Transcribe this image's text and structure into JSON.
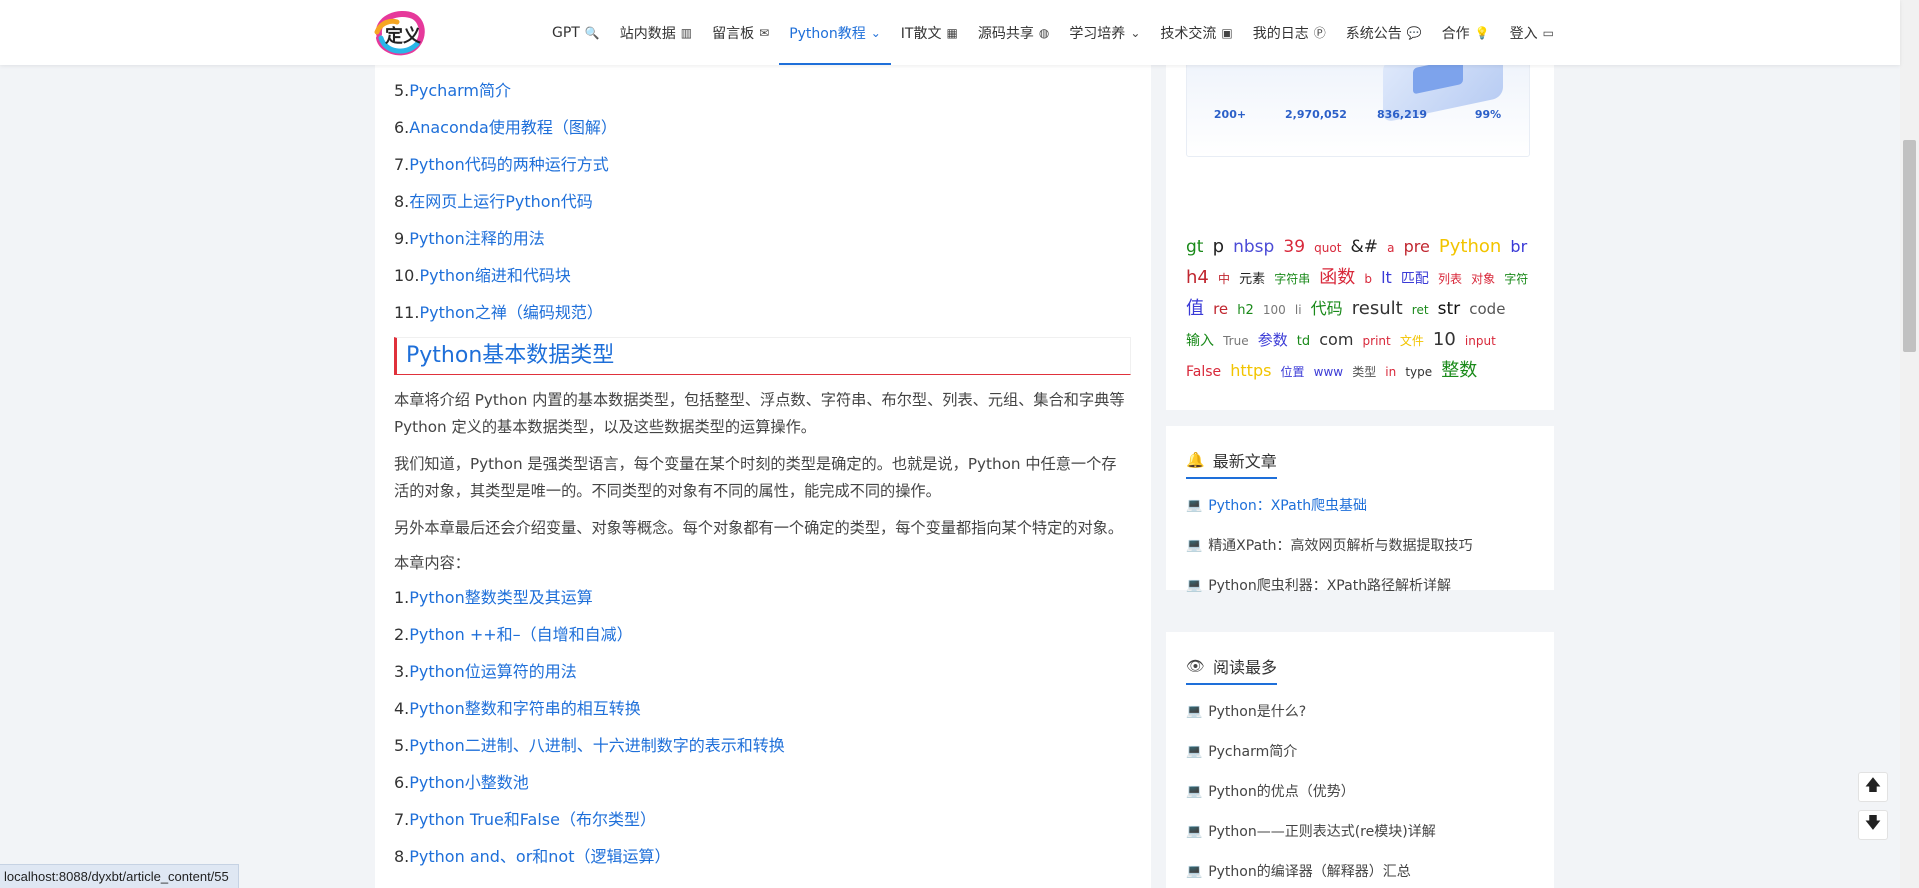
{
  "logo": {
    "text": "定义"
  },
  "nav": [
    {
      "label": "GPT",
      "icon": "🔍",
      "active": false
    },
    {
      "label": "站内数据",
      "icon": "▥",
      "active": false
    },
    {
      "label": "留言板",
      "icon": "✉",
      "active": false
    },
    {
      "label": "Python教程",
      "icon": "⌄",
      "active": true
    },
    {
      "label": "IT散文",
      "icon": "▦",
      "active": false
    },
    {
      "label": "源码共享",
      "icon": "◍",
      "active": false
    },
    {
      "label": "学习培养",
      "icon": "⌄",
      "active": false
    },
    {
      "label": "技术交流",
      "icon": "▣",
      "active": false
    },
    {
      "label": "我的日志",
      "icon": "Ⓟ",
      "active": false
    },
    {
      "label": "系统公告",
      "icon": "💬",
      "active": false
    },
    {
      "label": "合作",
      "icon": "💡",
      "active": false
    },
    {
      "label": "登入",
      "icon": "▭",
      "active": false
    }
  ],
  "article": {
    "top_items": [
      {
        "num": "5.",
        "title": "Pycharm简介"
      },
      {
        "num": "6.",
        "title": "Anaconda使用教程（图解）"
      },
      {
        "num": "7.",
        "title": "Python代码的两种运行方式"
      },
      {
        "num": "8.",
        "title": "在网页上运行Python代码"
      },
      {
        "num": "9.",
        "title": "Python注释的用法"
      },
      {
        "num": "10.",
        "title": "Python缩进和代码块"
      },
      {
        "num": "11.",
        "title": "Python之禅（编码规范）"
      }
    ],
    "section_title": "Python基本数据类型",
    "paragraphs": [
      "本章将介绍 Python 内置的基本数据类型，包括整型、浮点数、字符串、布尔型、列表、元组、集合和字典等 Python 定义的基本数据类型，以及这些数据类型的运算操作。",
      "我们知道，Python 是强类型语言，每个变量在某个时刻的类型是确定的。也就是说，Python 中任意一个存活的对象，其类型是唯一的。不同类型的对象有不同的属性，能完成不同的操作。",
      "另外本章最后还会介绍变量、对象等概念。每个对象都有一个确定的类型，每个变量都指向某个特定的对象。"
    ],
    "chapter_label": "本章内容：",
    "bottom_items": [
      {
        "num": "1.",
        "title": "Python整数类型及其运算"
      },
      {
        "num": "2.",
        "title": "Python ++和–（自增和自减）"
      },
      {
        "num": "3.",
        "title": "Python位运算符的用法"
      },
      {
        "num": "4.",
        "title": "Python整数和字符串的相互转换"
      },
      {
        "num": "5.",
        "title": "Python二进制、八进制、十六进制数字的表示和转换"
      },
      {
        "num": "6.",
        "title": "Python小整数池"
      },
      {
        "num": "7.",
        "title": "Python True和False（布尔类型）"
      },
      {
        "num": "8.",
        "title": "Python and、or和not（逻辑运算）"
      }
    ]
  },
  "banner": {
    "stats": [
      {
        "value": "200+",
        "label": ""
      },
      {
        "value": "2,970,052",
        "label": ""
      },
      {
        "value": "836,219",
        "label": ""
      },
      {
        "value": "99%",
        "label": ""
      }
    ]
  },
  "tags": [
    {
      "text": "gt",
      "color": "#1a8a1a",
      "size": 17
    },
    {
      "text": "p",
      "color": "#222222",
      "size": 18
    },
    {
      "text": "nbsp",
      "color": "#4b4bd6",
      "size": 17
    },
    {
      "text": "39",
      "color": "#d8283a",
      "size": 17
    },
    {
      "text": "quot",
      "color": "#d8283a",
      "size": 12
    },
    {
      "text": "&#",
      "color": "#222222",
      "size": 17
    },
    {
      "text": "a",
      "color": "#d8283a",
      "size": 12
    },
    {
      "text": "pre",
      "color": "#c0262f",
      "size": 16
    },
    {
      "text": "Python",
      "color": "#f2c400",
      "size": 18
    },
    {
      "text": "br",
      "color": "#3a3ad6",
      "size": 16
    },
    {
      "text": "h4",
      "color": "#c0262f",
      "size": 18
    },
    {
      "text": "中",
      "color": "#c0262f",
      "size": 12
    },
    {
      "text": "元素",
      "color": "#222222",
      "size": 13
    },
    {
      "text": "字符串",
      "color": "#1a8a1a",
      "size": 12
    },
    {
      "text": "函数",
      "color": "#d8283a",
      "size": 18
    },
    {
      "text": "b",
      "color": "#d8283a",
      "size": 12
    },
    {
      "text": "lt",
      "color": "#3a3ad6",
      "size": 16
    },
    {
      "text": "匹配",
      "color": "#3a3ad6",
      "size": 14
    },
    {
      "text": "列表",
      "color": "#d8283a",
      "size": 12
    },
    {
      "text": "对象",
      "color": "#d8283a",
      "size": 12
    },
    {
      "text": "字符",
      "color": "#1a8a1a",
      "size": 12
    },
    {
      "text": "值",
      "color": "#3a3ad6",
      "size": 18
    },
    {
      "text": "re",
      "color": "#c0262f",
      "size": 15
    },
    {
      "text": "h2",
      "color": "#1a8a1a",
      "size": 13
    },
    {
      "text": "100",
      "color": "#777777",
      "size": 12
    },
    {
      "text": "li",
      "color": "#777777",
      "size": 12
    },
    {
      "text": "代码",
      "color": "#1a8a1a",
      "size": 16
    },
    {
      "text": "result",
      "color": "#333333",
      "size": 18
    },
    {
      "text": "ret",
      "color": "#1a8a1a",
      "size": 12
    },
    {
      "text": "str",
      "color": "#111111",
      "size": 17
    },
    {
      "text": "code",
      "color": "#555555",
      "size": 15
    },
    {
      "text": "输入",
      "color": "#1a8a1a",
      "size": 14
    },
    {
      "text": "True",
      "color": "#777777",
      "size": 12
    },
    {
      "text": "参数",
      "color": "#3a3ad6",
      "size": 15
    },
    {
      "text": "td",
      "color": "#1a8a1a",
      "size": 13
    },
    {
      "text": "com",
      "color": "#333333",
      "size": 16
    },
    {
      "text": "print",
      "color": "#d8283a",
      "size": 12
    },
    {
      "text": "文件",
      "color": "#f2c400",
      "size": 12
    },
    {
      "text": "10",
      "color": "#333333",
      "size": 18
    },
    {
      "text": "input",
      "color": "#d8283a",
      "size": 12
    },
    {
      "text": "False",
      "color": "#d8283a",
      "size": 14
    },
    {
      "text": "https",
      "color": "#f2c400",
      "size": 16
    },
    {
      "text": "位置",
      "color": "#3a3ad6",
      "size": 12
    },
    {
      "text": "www",
      "color": "#3a3ad6",
      "size": 12
    },
    {
      "text": "类型",
      "color": "#555555",
      "size": 12
    },
    {
      "text": "in",
      "color": "#d8283a",
      "size": 12
    },
    {
      "text": "type",
      "color": "#333333",
      "size": 12
    },
    {
      "text": "整数",
      "color": "#1a8a1a",
      "size": 18
    }
  ],
  "latest": {
    "title": "最新文章",
    "icon": "🔔",
    "items": [
      {
        "text": "Python：XPath爬虫基础",
        "highlight": true
      },
      {
        "text": "精通XPath：高效网页解析与数据提取技巧",
        "highlight": false
      },
      {
        "text": "Python爬虫利器：XPath路径解析详解",
        "highlight": false
      }
    ]
  },
  "popular": {
    "title": "阅读最多",
    "icon": "👁",
    "items": [
      {
        "text": "Python是什么?"
      },
      {
        "text": "Pycharm简介"
      },
      {
        "text": "Python的优点（优势）"
      },
      {
        "text": "Python——正则表达式(re模块)详解"
      },
      {
        "text": "Python的编译器（解释器）汇总"
      }
    ]
  },
  "list_icon": "💻",
  "float_buttons": {
    "up": "🡅",
    "down": "🡇"
  },
  "status_url": "localhost:8088/dyxbt/article_content/55",
  "colors": {
    "link": "#1e6fd9",
    "accent_red": "#e0313b"
  }
}
